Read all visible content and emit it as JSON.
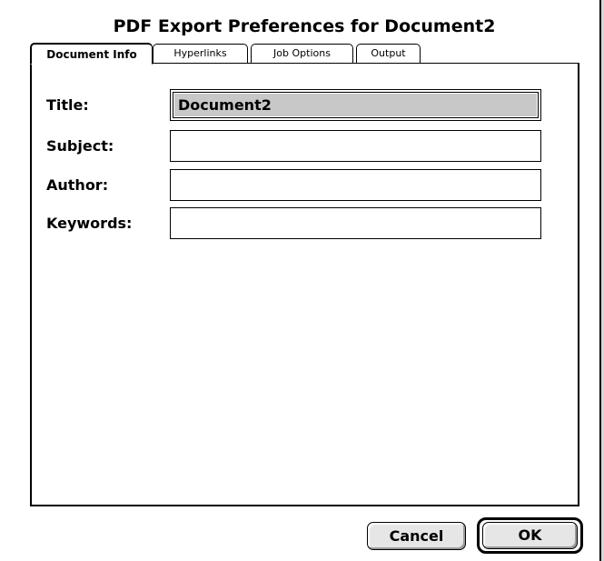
{
  "dialog": {
    "title": "PDF Export Preferences for Document2"
  },
  "tabs": [
    {
      "label": "Document Info",
      "active": true
    },
    {
      "label": "Hyperlinks",
      "active": false
    },
    {
      "label": "Job Options",
      "active": false
    },
    {
      "label": "Output",
      "active": false
    }
  ],
  "fields": {
    "title": {
      "label": "Title:",
      "value": "Document2",
      "selected": true
    },
    "subject": {
      "label": "Subject:",
      "value": ""
    },
    "author": {
      "label": "Author:",
      "value": ""
    },
    "keywords": {
      "label": "Keywords:",
      "value": ""
    }
  },
  "buttons": {
    "cancel_label": "Cancel",
    "ok_label": "OK"
  },
  "colors": {
    "selection_highlight": "#c8c8c8",
    "button_face": "#e6e6e6"
  }
}
